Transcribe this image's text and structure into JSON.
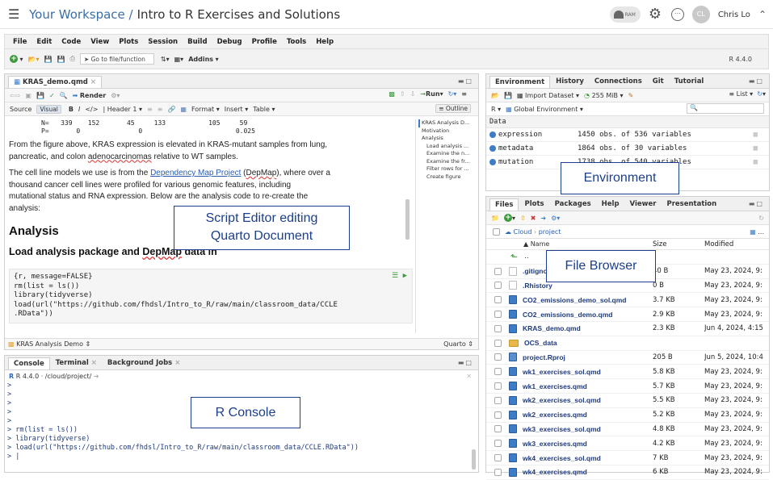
{
  "topbar": {
    "workspace": "Your Workspace /",
    "project": "Intro to R Exercises and Solutions",
    "ram_label": "RAM",
    "user": "Chris Lo",
    "avatar_initials": "CL"
  },
  "menu": [
    "File",
    "Edit",
    "Code",
    "View",
    "Plots",
    "Session",
    "Build",
    "Debug",
    "Profile",
    "Tools",
    "Help"
  ],
  "toolbar": {
    "goto_placeholder": "Go to file/function",
    "addins": "Addins",
    "r_version": "R 4.4.0"
  },
  "editor": {
    "tab": "KRAS_demo.qmd",
    "render_label": "Render",
    "run_label": "Run",
    "source_label": "Source",
    "visual_label": "Visual",
    "header_select": "Header 1",
    "format_menu": "Format",
    "insert_menu": "Insert",
    "table_menu": "Table",
    "outline_label": "Outline",
    "top_line1": "N=   339    152       45     133           105     59",
    "top_line2": "P=       0               0                        0.025",
    "para1a": "From the figure above, KRAS expression is elevated in KRAS-mutant samples from lung,",
    "para1b": "pancreatic, and colon ",
    "para1c": "adenocarcinomas",
    "para1d": " relative to WT samples.",
    "para2a": "The cell line models we use is from the ",
    "para2link": "Dependency Map Project",
    "para2b": " (",
    "para2c": "DepMap",
    "para2d": "), where over a",
    "para2e": "thousand cancer cell lines were profiled for various genomic features, including",
    "para2f": "mutational status and RNA expression. Below are the analysis code to re-create the",
    "para2g": "analysis:",
    "h2": "Analysis",
    "h3a": "Load analysis package and ",
    "h3b": "DepMap",
    "h3c": " data in",
    "code": [
      "{r, message=FALSE}",
      "rm(list = ls())",
      "library(tidyverse)",
      "load(url(\"https://github.com/fhdsl/Intro_to_R/raw/main/classroom_data/CCLE",
      ".RData\"))"
    ],
    "outline": [
      "KRAS Analysis D...",
      "Motivation",
      "Analysis",
      "Load analysis ...",
      "Examine the n...",
      "Examine the fr...",
      "Filter rows for ...",
      "Create figure"
    ],
    "status_left": "KRAS Analysis Demo",
    "status_right": "Quarto"
  },
  "console": {
    "tabs": [
      "Console",
      "Terminal",
      "Background Jobs"
    ],
    "path": "R 4.4.0 · /cloud/project/",
    "lines": [
      ">",
      ">",
      ">",
      ">",
      ">",
      "> rm(list = ls())",
      "> library(tidyverse)",
      "> load(url(\"https://github.com/fhdsl/Intro_to_R/raw/main/classroom_data/CCLE.RData\"))",
      "> |"
    ]
  },
  "environment": {
    "tabs": [
      "Environment",
      "History",
      "Connections",
      "Git",
      "Tutorial"
    ],
    "import_label": "Import Dataset",
    "mem_label": "255 MiB",
    "list_label": "List",
    "r_label": "R",
    "scope_label": "Global Environment",
    "section": "Data",
    "rows": [
      {
        "name": "expression",
        "value": "1450 obs. of 536 variables"
      },
      {
        "name": "metadata",
        "value": "1864 obs. of 30 variables"
      },
      {
        "name": "mutation",
        "value": "1738 obs. of 540 variables"
      }
    ]
  },
  "files": {
    "tabs": [
      "Files",
      "Plots",
      "Packages",
      "Help",
      "Viewer",
      "Presentation"
    ],
    "breadcrumb": [
      "Cloud",
      "project"
    ],
    "headers": {
      "name": "▲ Name",
      "size": "Size",
      "modified": "Modified"
    },
    "up_label": "..",
    "rows": [
      {
        "name": ".gitignore",
        "size": "40 B",
        "modified": "May 23, 2024, 9:",
        "icon": "git"
      },
      {
        "name": ".Rhistory",
        "size": "0 B",
        "modified": "May 23, 2024, 9:",
        "icon": "doc"
      },
      {
        "name": "CO2_emissions_demo_sol.qmd",
        "size": "3.7 KB",
        "modified": "May 23, 2024, 9:",
        "icon": "qmd"
      },
      {
        "name": "CO2_emissions_demo.qmd",
        "size": "2.9 KB",
        "modified": "May 23, 2024, 9:",
        "icon": "qmd"
      },
      {
        "name": "KRAS_demo.qmd",
        "size": "2.3 KB",
        "modified": "Jun 4, 2024, 4:15",
        "icon": "qmd"
      },
      {
        "name": "OCS_data",
        "size": "",
        "modified": "",
        "icon": "folder"
      },
      {
        "name": "project.Rproj",
        "size": "205 B",
        "modified": "Jun 5, 2024, 10:4",
        "icon": "rproj"
      },
      {
        "name": "wk1_exercises_sol.qmd",
        "size": "5.8 KB",
        "modified": "May 23, 2024, 9:",
        "icon": "qmd"
      },
      {
        "name": "wk1_exercises.qmd",
        "size": "5.7 KB",
        "modified": "May 23, 2024, 9:",
        "icon": "qmd"
      },
      {
        "name": "wk2_exercises_sol.qmd",
        "size": "5.5 KB",
        "modified": "May 23, 2024, 9:",
        "icon": "qmd"
      },
      {
        "name": "wk2_exercises.qmd",
        "size": "5.2 KB",
        "modified": "May 23, 2024, 9:",
        "icon": "qmd"
      },
      {
        "name": "wk3_exercises_sol.qmd",
        "size": "4.8 KB",
        "modified": "May 23, 2024, 9:",
        "icon": "qmd"
      },
      {
        "name": "wk3_exercises.qmd",
        "size": "4.2 KB",
        "modified": "May 23, 2024, 9:",
        "icon": "qmd"
      },
      {
        "name": "wk4_exercises_sol.qmd",
        "size": "7 KB",
        "modified": "May 23, 2024, 9:",
        "icon": "qmd"
      },
      {
        "name": "wk4_exercises.qmd",
        "size": "6 KB",
        "modified": "May 23, 2024, 9:",
        "icon": "qmd"
      }
    ]
  },
  "annotations": {
    "editor_line1": "Script Editor editing",
    "editor_line2": "Quarto Document",
    "environment": "Environment",
    "files": "File Browser",
    "console": "R Console"
  },
  "colors": {
    "accent": "#3b6ea5",
    "annotation": "#1b3f8c",
    "console_text": "#1f3a7a"
  }
}
